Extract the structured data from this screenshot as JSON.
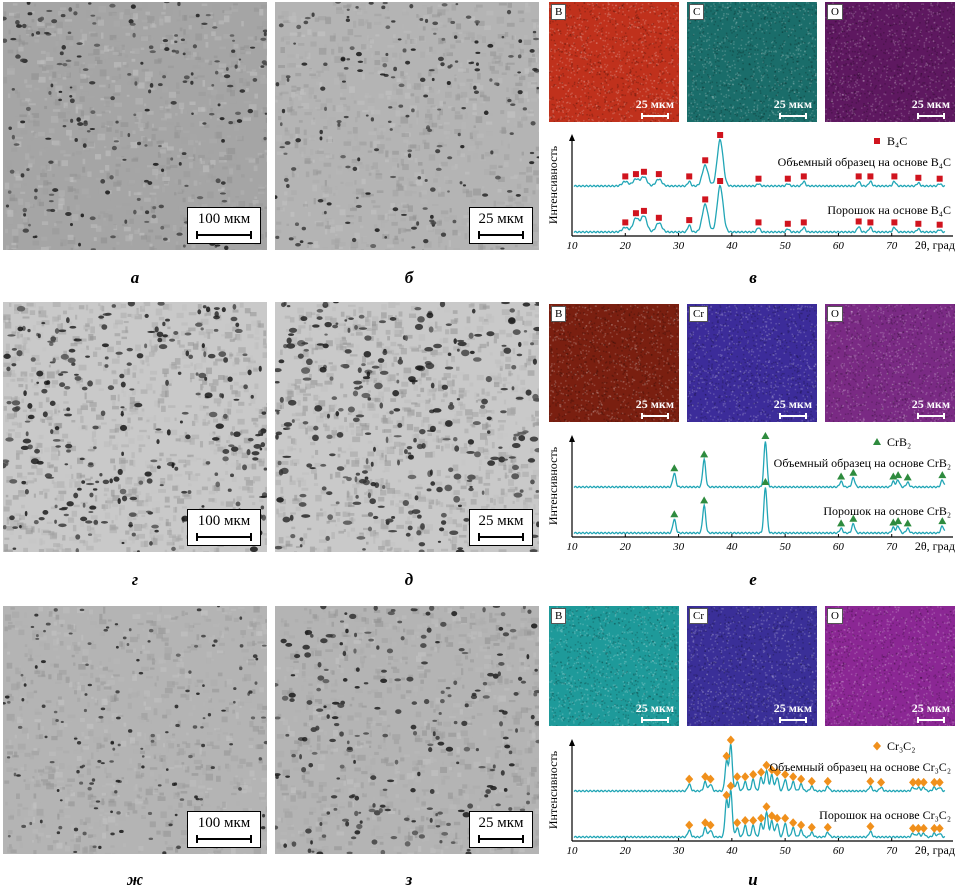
{
  "rows": [
    {
      "sem": [
        {
          "scale": "100 мкм",
          "letter": "а"
        },
        {
          "scale": "25 мкм",
          "letter": "б"
        }
      ],
      "eds": [
        {
          "element": "B",
          "scale": "25 мкм",
          "color": "#c0311c"
        },
        {
          "element": "C",
          "scale": "25 мкм",
          "color": "#1f8f8a"
        },
        {
          "element": "O",
          "scale": "25 мкм",
          "color": "#7b1f7d"
        }
      ],
      "letter": "в",
      "xrd": {
        "ylabel": "Интенсивность",
        "legend": "B₄C",
        "marker": "square",
        "marker_color": "#d0141e",
        "line_color": "#22a6b6",
        "upper_label": "Объемный образец на основе B₄C",
        "lower_label": "Порошок на основе B₄C"
      }
    },
    {
      "sem": [
        {
          "scale": "100 мкм",
          "letter": "г"
        },
        {
          "scale": "25 мкм",
          "letter": "д"
        }
      ],
      "eds": [
        {
          "element": "B",
          "scale": "25 мкм",
          "color": "#8a2412"
        },
        {
          "element": "Cr",
          "scale": "25 мкм",
          "color": "#3c2c9a"
        },
        {
          "element": "O",
          "scale": "25 мкм",
          "color": "#7a2a84"
        }
      ],
      "letter": "е",
      "xrd": {
        "ylabel": "Интенсивность",
        "legend": "CrB₂",
        "marker": "triangle",
        "marker_color": "#2e8b3e",
        "line_color": "#22a6b6",
        "upper_label": "Объемный образец на основе CrB₂",
        "lower_label": "Порошок на основе CrB₂"
      }
    },
    {
      "sem": [
        {
          "scale": "100 мкм",
          "letter": "ж"
        },
        {
          "scale": "25 мкм",
          "letter": "з"
        }
      ],
      "eds": [
        {
          "element": "B",
          "scale": "25 мкм",
          "color": "#1e9a9a"
        },
        {
          "element": "Cr",
          "scale": "25 мкм",
          "color": "#3a2f98"
        },
        {
          "element": "O",
          "scale": "25 мкм",
          "color": "#8b2794"
        }
      ],
      "letter": "и",
      "xrd": {
        "ylabel": "Интенсивность",
        "legend": "Cr₃C₂",
        "marker": "diamond",
        "marker_color": "#f0901c",
        "line_color": "#22a6b6",
        "upper_label": "Объемный образец на основе Cr₃C₂",
        "lower_label": "Порошок на основе Cr₃C₂"
      }
    }
  ],
  "xrd_axis": {
    "xlabel": "2θ, град",
    "ticks": [
      "10",
      "20",
      "30",
      "40",
      "50",
      "60",
      "70"
    ],
    "xlim": [
      10,
      80
    ]
  },
  "chart_data": [
    {
      "type": "line",
      "title": "",
      "xlabel": "2θ, град",
      "ylabel": "Интенсивность",
      "xlim": [
        10,
        80
      ],
      "series": [
        {
          "name": "Объемный образец на основе B₄C",
          "peaks": [
            [
              20,
              0.1
            ],
            [
              22,
              0.15
            ],
            [
              23.5,
              0.2
            ],
            [
              26.3,
              0.15
            ],
            [
              32,
              0.1
            ],
            [
              35,
              0.45
            ],
            [
              37.8,
              1.0
            ],
            [
              45,
              0.05
            ],
            [
              50.5,
              0.05
            ],
            [
              53.5,
              0.1
            ],
            [
              63.8,
              0.1
            ],
            [
              66,
              0.1
            ],
            [
              70.5,
              0.1
            ],
            [
              75,
              0.07
            ],
            [
              79,
              0.05
            ]
          ]
        },
        {
          "name": "Порошок на основе B₄C",
          "peaks": [
            [
              20,
              0.1
            ],
            [
              22,
              0.3
            ],
            [
              23.5,
              0.35
            ],
            [
              26.3,
              0.2
            ],
            [
              32,
              0.15
            ],
            [
              35,
              0.6
            ],
            [
              37.8,
              1.0
            ],
            [
              45,
              0.1
            ],
            [
              50.5,
              0.07
            ],
            [
              53.5,
              0.1
            ],
            [
              63.8,
              0.12
            ],
            [
              66,
              0.1
            ],
            [
              70.5,
              0.1
            ],
            [
              75,
              0.07
            ],
            [
              79,
              0.05
            ]
          ]
        }
      ],
      "legend": [
        "B₄C"
      ]
    },
    {
      "type": "line",
      "title": "",
      "xlabel": "2θ, град",
      "ylabel": "Интенсивность",
      "xlim": [
        10,
        80
      ],
      "series": [
        {
          "name": "Объемный образец на основе CrB₂",
          "peaks": [
            [
              29.2,
              0.3
            ],
            [
              34.8,
              0.6
            ],
            [
              46.3,
              1.0
            ],
            [
              60.5,
              0.12
            ],
            [
              62.8,
              0.2
            ],
            [
              70.3,
              0.12
            ],
            [
              71.2,
              0.15
            ],
            [
              73,
              0.1
            ],
            [
              79.5,
              0.15
            ]
          ]
        },
        {
          "name": "Порошок на основе CrB₂",
          "peaks": [
            [
              29.2,
              0.3
            ],
            [
              34.8,
              0.6
            ],
            [
              46.3,
              1.0
            ],
            [
              60.5,
              0.1
            ],
            [
              62.8,
              0.2
            ],
            [
              70.3,
              0.12
            ],
            [
              71.2,
              0.15
            ],
            [
              73,
              0.1
            ],
            [
              79.5,
              0.15
            ]
          ]
        }
      ],
      "legend": [
        "CrB₂"
      ]
    },
    {
      "type": "line",
      "title": "",
      "xlabel": "2θ, град",
      "ylabel": "Интенсивность",
      "xlim": [
        10,
        80
      ],
      "series": [
        {
          "name": "Объемный образец на основе Cr₃C₂",
          "peaks": [
            [
              32,
              0.15
            ],
            [
              35,
              0.2
            ],
            [
              36,
              0.15
            ],
            [
              39,
              0.65
            ],
            [
              39.8,
              1.0
            ],
            [
              41,
              0.2
            ],
            [
              42.5,
              0.2
            ],
            [
              44,
              0.25
            ],
            [
              45.5,
              0.3
            ],
            [
              46.5,
              0.45
            ],
            [
              47.5,
              0.35
            ],
            [
              48.5,
              0.3
            ],
            [
              50,
              0.25
            ],
            [
              51.5,
              0.2
            ],
            [
              53,
              0.15
            ],
            [
              55,
              0.1
            ],
            [
              58,
              0.1
            ],
            [
              66,
              0.1
            ],
            [
              68,
              0.08
            ],
            [
              74,
              0.08
            ],
            [
              75,
              0.08
            ],
            [
              76,
              0.08
            ],
            [
              78,
              0.08
            ],
            [
              79,
              0.08
            ]
          ]
        },
        {
          "name": "Порошок на основе Cr₃C₂",
          "peaks": [
            [
              32,
              0.15
            ],
            [
              35,
              0.2
            ],
            [
              36,
              0.15
            ],
            [
              39,
              0.8
            ],
            [
              39.8,
              1.0
            ],
            [
              41,
              0.2
            ],
            [
              42.5,
              0.25
            ],
            [
              44,
              0.25
            ],
            [
              45.5,
              0.3
            ],
            [
              46.5,
              0.55
            ],
            [
              47.5,
              0.35
            ],
            [
              48.5,
              0.3
            ],
            [
              50,
              0.3
            ],
            [
              51.5,
              0.2
            ],
            [
              53,
              0.15
            ],
            [
              55,
              0.1
            ],
            [
              58,
              0.1
            ],
            [
              66,
              0.12
            ],
            [
              74,
              0.08
            ],
            [
              75,
              0.08
            ],
            [
              76,
              0.08
            ],
            [
              78,
              0.08
            ],
            [
              79,
              0.08
            ]
          ]
        }
      ],
      "legend": [
        "Cr₃C₂"
      ]
    }
  ]
}
